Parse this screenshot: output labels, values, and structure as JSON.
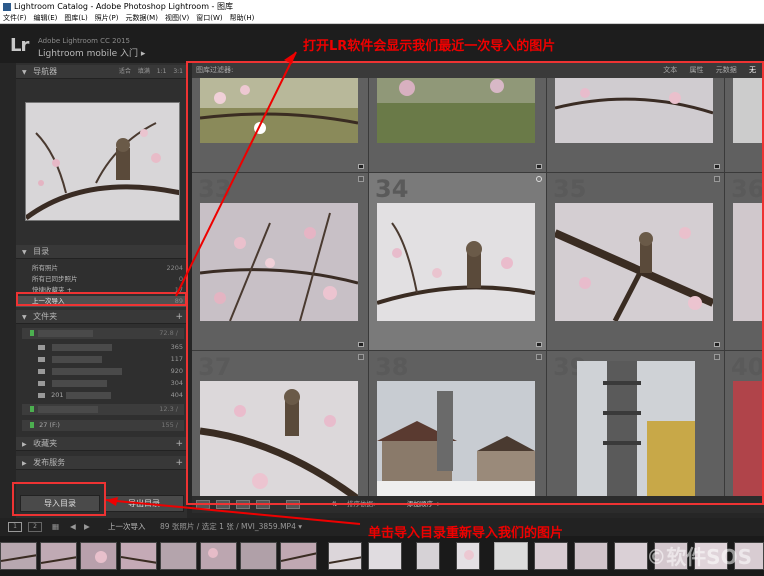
{
  "window": {
    "title": "Lightroom Catalog - Adobe Photoshop Lightroom - 图库"
  },
  "menu": [
    "文件(F)",
    "编辑(E)",
    "图库(L)",
    "照片(P)",
    "元数据(M)",
    "视图(V)",
    "窗口(W)",
    "帮助(H)"
  ],
  "identity": {
    "logo": "Lr",
    "version": "Adobe Lightroom CC 2015",
    "mobile": "Lightroom mobile 入门 ▸"
  },
  "navigator": {
    "title": "导航器",
    "options": [
      "适合",
      "填满",
      "1:1",
      "3:1"
    ]
  },
  "catalog": {
    "title": "目录",
    "items": [
      {
        "label": "所有照片",
        "count": "2204"
      },
      {
        "label": "所有已同步照片",
        "count": "0"
      },
      {
        "label": "快捷收藏夹 +",
        "count": "17"
      },
      {
        "label": "上一次导入",
        "count": "89"
      }
    ]
  },
  "folders": {
    "title": "文件夹",
    "drive1": {
      "count": "72.8 / "
    },
    "rows": [
      {
        "label": "",
        "count": "365"
      },
      {
        "label": "",
        "count": "117"
      },
      {
        "label": "",
        "count": "920"
      },
      {
        "label": "",
        "count": "304"
      },
      {
        "label": "201",
        "count": "404"
      }
    ],
    "drive2": {
      "count": "12.3 / "
    },
    "drive3": {
      "label": "27 (F:)",
      "count": "155 / "
    }
  },
  "collections": {
    "title": "收藏夹"
  },
  "publish": {
    "title": "发布服务"
  },
  "buttons": {
    "import": "导入目录",
    "export": "导出目录"
  },
  "filterbar": {
    "label": "图库过滤器:",
    "options": [
      "文本",
      "属性",
      "元数据",
      "无"
    ]
  },
  "grid": {
    "row1_numbers": [
      "",
      "",
      "",
      ""
    ],
    "row2_numbers": [
      "33",
      "34",
      "35",
      "36"
    ],
    "row3_numbers": [
      "37",
      "38",
      "39",
      "40"
    ]
  },
  "toolbar": {
    "sort_label": "排序依据:",
    "sort_value": "添加顺序 ÷"
  },
  "filmstrip_head": {
    "pages": [
      "1",
      "2"
    ],
    "source": "上一次导入",
    "info": "89 张照片 / 选定 1 张 / MVI_3859.MP4 ▾"
  },
  "annotations": {
    "top": "打开LR软件会显示我们最近一次导入的图片",
    "bottom": "单击导入目录重新导入我们的图片",
    "color": "#e00000"
  },
  "watermark": "©软件SOS"
}
